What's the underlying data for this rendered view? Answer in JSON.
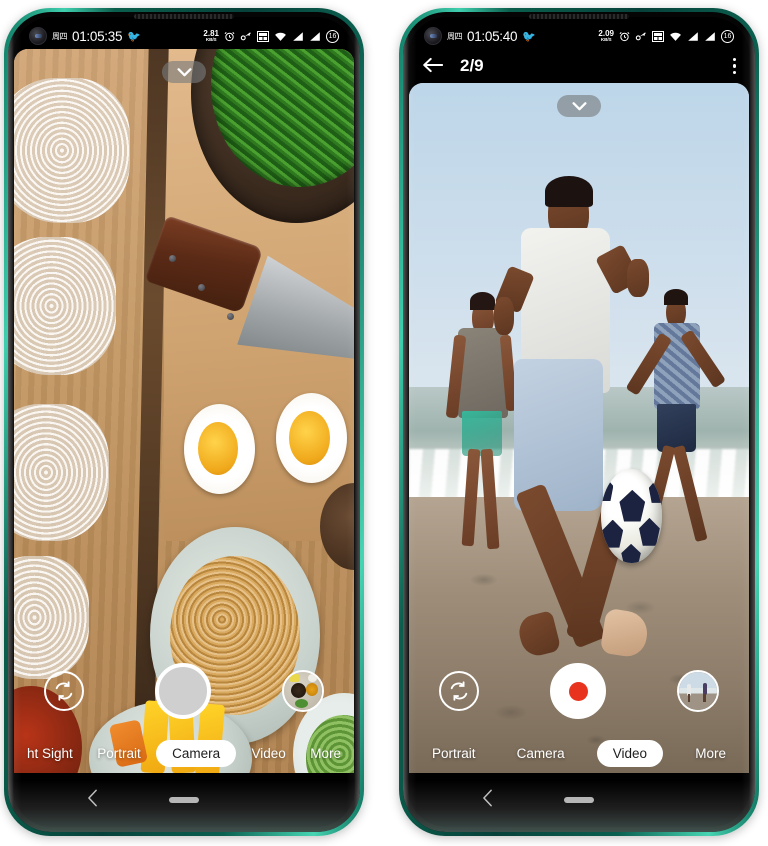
{
  "device": {
    "frame_color": "#0d6e5a",
    "count": 2
  },
  "phone_left": {
    "status_bar": {
      "day": "周四",
      "time": "01:05:35",
      "app_icon": "bird-icon",
      "net_speed_value": "2.81",
      "net_speed_unit": "KB/S",
      "icons": [
        "alarm-icon",
        "key-icon",
        "vpn-icon",
        "wifi-icon",
        "signal-icon-1",
        "signal-icon-2"
      ],
      "battery": "16"
    },
    "viewfinder": {
      "scene": "food-flatlay",
      "expand_icon": "chevron-down-icon"
    },
    "controls": {
      "flip_icon": "camera-flip-icon",
      "shutter": "photo-shutter-button",
      "thumbnail": "gallery-thumbnail-food"
    },
    "modes": [
      {
        "label": "ht Sight",
        "active": false,
        "clipped": true
      },
      {
        "label": "Portrait",
        "active": false
      },
      {
        "label": "Camera",
        "active": true
      },
      {
        "label": "Video",
        "active": false
      },
      {
        "label": "More",
        "active": false
      }
    ],
    "navbar": {
      "back_icon": "back-chevron-icon",
      "home_handle": "home-pill"
    }
  },
  "phone_right": {
    "status_bar": {
      "day": "周四",
      "time": "01:05:40",
      "app_icon": "bird-icon",
      "net_speed_value": "2.09",
      "net_speed_unit": "KB/S",
      "icons": [
        "alarm-icon",
        "key-icon",
        "vpn-icon",
        "wifi-icon",
        "signal-icon-1",
        "signal-icon-2"
      ],
      "battery": "16"
    },
    "header": {
      "back_icon": "back-arrow-icon",
      "title": "2/9",
      "menu_icon": "overflow-menu-icon"
    },
    "viewfinder": {
      "scene": "beach-football",
      "expand_icon": "chevron-down-icon"
    },
    "controls": {
      "flip_icon": "camera-flip-icon",
      "shutter": "video-record-button",
      "record_dot_color": "#e8341f",
      "thumbnail": "gallery-thumbnail-beach"
    },
    "modes": [
      {
        "label": "Portrait",
        "active": false
      },
      {
        "label": "Camera",
        "active": false
      },
      {
        "label": "Video",
        "active": true
      },
      {
        "label": "More",
        "active": false
      }
    ],
    "navbar": {
      "back_icon": "back-chevron-icon",
      "home_handle": "home-pill"
    }
  }
}
